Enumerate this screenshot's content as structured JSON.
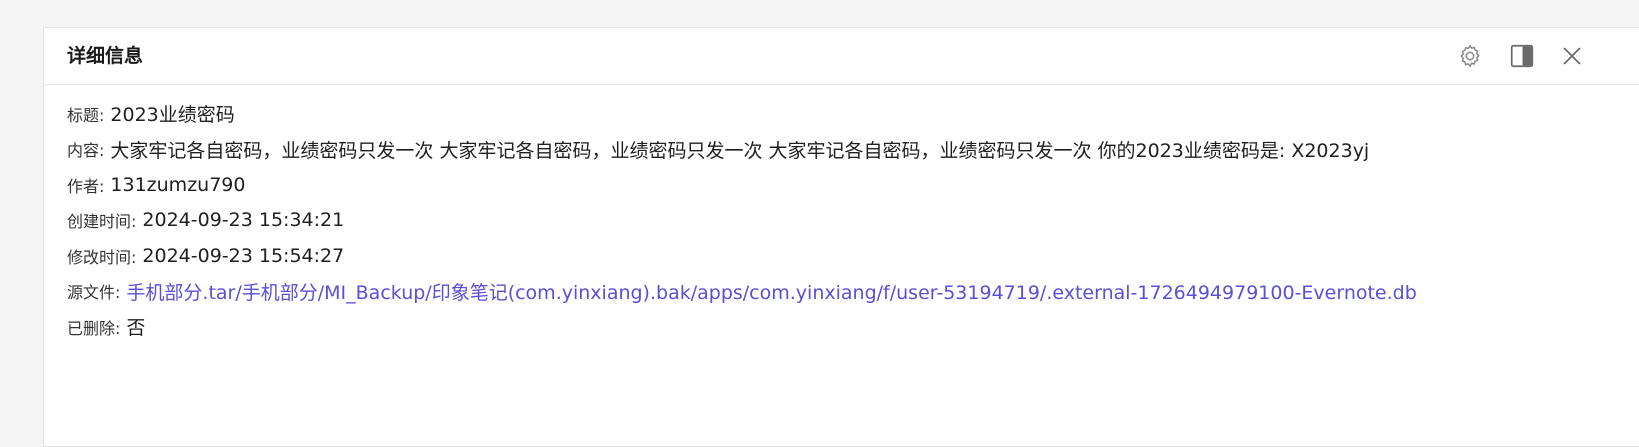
{
  "panel": {
    "title": "详细信息",
    "gear_icon": "gear-icon",
    "panel_icon": "sidebar-panel-icon",
    "close_icon": "close-icon"
  },
  "fields": [
    {
      "label": "标题:",
      "value": "2023业绩密码"
    },
    {
      "label": "内容:",
      "value": "大家牢记各自密码，业绩密码只发一次 大家牢记各自密码，业绩密码只发一次 大家牢记各自密码，业绩密码只发一次 你的2023业绩密码是: X2023yj"
    },
    {
      "label": "作者:",
      "value": "131zumzu790"
    },
    {
      "label": "创建时间:",
      "value": "2024-09-23 15:34:21"
    },
    {
      "label": "修改时间:",
      "value": "2024-09-23 15:54:27"
    },
    {
      "label": "源文件:",
      "value": "手机部分.tar/手机部分/MI_Backup/印象笔记(com.yinxiang).bak/apps/com.yinxiang/f/user-53194719/.external-1726494979100-Evernote.db"
    },
    {
      "label": "已删除:",
      "value": "否"
    }
  ],
  "colors": {
    "link": "#5a4fd8",
    "title": "#1a1a1a",
    "label": "#333333"
  }
}
